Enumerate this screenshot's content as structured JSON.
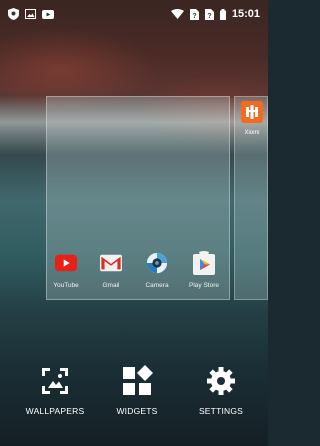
{
  "status_bar": {
    "time": "15:01",
    "left_icons": [
      "shield-icon",
      "image-icon",
      "youtube-notification-icon"
    ],
    "right_icons": [
      "wifi-icon",
      "sim-1-icon",
      "sim-2-icon",
      "battery-icon"
    ]
  },
  "preview": {
    "apps": [
      {
        "label": "YouTube",
        "icon": "youtube-icon",
        "color": "#e62117"
      },
      {
        "label": "Gmail",
        "icon": "gmail-icon",
        "color": "#d93025"
      },
      {
        "label": "Camera",
        "icon": "camera-icon",
        "color": "#4aa3df"
      },
      {
        "label": "Play Store",
        "icon": "play-store-icon",
        "color": "#34a853"
      }
    ]
  },
  "next_page": {
    "app_label": "Xiomi",
    "icon": "xiaomi-icon",
    "color": "#f26b21"
  },
  "actions": {
    "wallpapers": "WALLPAPERS",
    "widgets": "WIDGETS",
    "settings": "SETTINGS"
  }
}
